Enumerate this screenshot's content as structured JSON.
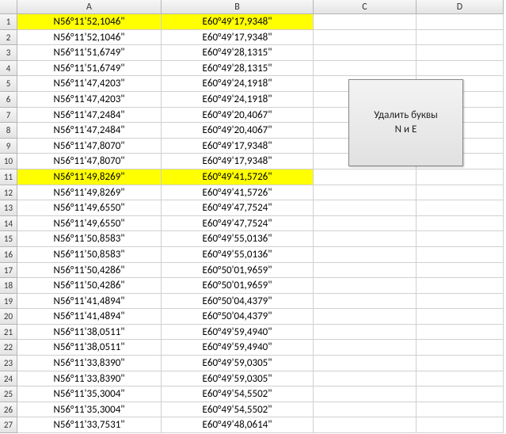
{
  "columns": [
    "A",
    "B",
    "C",
    "D"
  ],
  "highlight_rows": [
    0,
    10
  ],
  "button": {
    "line1": "Удалить буквы",
    "line2": "N и E"
  },
  "rows": [
    {
      "n": "1",
      "a": "N56°11'52,1046\"",
      "b": "E60°49'17,9348\""
    },
    {
      "n": "2",
      "a": "N56°11'52,1046\"",
      "b": "E60°49'17,9348\""
    },
    {
      "n": "3",
      "a": "N56°11'51,6749\"",
      "b": "E60°49'28,1315\""
    },
    {
      "n": "4",
      "a": "N56°11'51,6749\"",
      "b": "E60°49'28,1315\""
    },
    {
      "n": "5",
      "a": "N56°11'47,4203\"",
      "b": "E60°49'24,1918\""
    },
    {
      "n": "6",
      "a": "N56°11'47,4203\"",
      "b": "E60°49'24,1918\""
    },
    {
      "n": "7",
      "a": "N56°11'47,2484\"",
      "b": "E60°49'20,4067\""
    },
    {
      "n": "8",
      "a": "N56°11'47,2484\"",
      "b": "E60°49'20,4067\""
    },
    {
      "n": "9",
      "a": "N56°11'47,8070\"",
      "b": "E60°49'17,9348\""
    },
    {
      "n": "10",
      "a": "N56°11'47,8070\"",
      "b": "E60°49'17,9348\""
    },
    {
      "n": "11",
      "a": "N56°11'49,8269\"",
      "b": "E60°49'41,5726\""
    },
    {
      "n": "12",
      "a": "N56°11'49,8269\"",
      "b": "E60°49'41,5726\""
    },
    {
      "n": "13",
      "a": "N56°11'49,6550\"",
      "b": "E60°49'47,7524\""
    },
    {
      "n": "14",
      "a": "N56°11'49,6550\"",
      "b": "E60°49'47,7524\""
    },
    {
      "n": "15",
      "a": "N56°11'50,8583\"",
      "b": "E60°49'55,0136\""
    },
    {
      "n": "16",
      "a": "N56°11'50,8583\"",
      "b": "E60°49'55,0136\""
    },
    {
      "n": "17",
      "a": "N56°11'50,4286\"",
      "b": "E60°50'01,9659\""
    },
    {
      "n": "18",
      "a": "N56°11'50,4286\"",
      "b": "E60°50'01,9659\""
    },
    {
      "n": "19",
      "a": "N56°11'41,4894\"",
      "b": "E60°50'04,4379\""
    },
    {
      "n": "20",
      "a": "N56°11'41,4894\"",
      "b": "E60°50'04,4379\""
    },
    {
      "n": "21",
      "a": "N56°11'38,0511\"",
      "b": "E60°49'59,4940\""
    },
    {
      "n": "22",
      "a": "N56°11'38,0511\"",
      "b": "E60°49'59,4940\""
    },
    {
      "n": "23",
      "a": "N56°11'33,8390\"",
      "b": "E60°49'59,0305\""
    },
    {
      "n": "24",
      "a": "N56°11'33,8390\"",
      "b": "E60°49'59,0305\""
    },
    {
      "n": "25",
      "a": "N56°11'35,3004\"",
      "b": "E60°49'54,5502\""
    },
    {
      "n": "26",
      "a": "N56°11'35,3004\"",
      "b": "E60°49'54,5502\""
    },
    {
      "n": "27",
      "a": "N56°11'33,7531\"",
      "b": "E60°49'48,0614\""
    }
  ]
}
